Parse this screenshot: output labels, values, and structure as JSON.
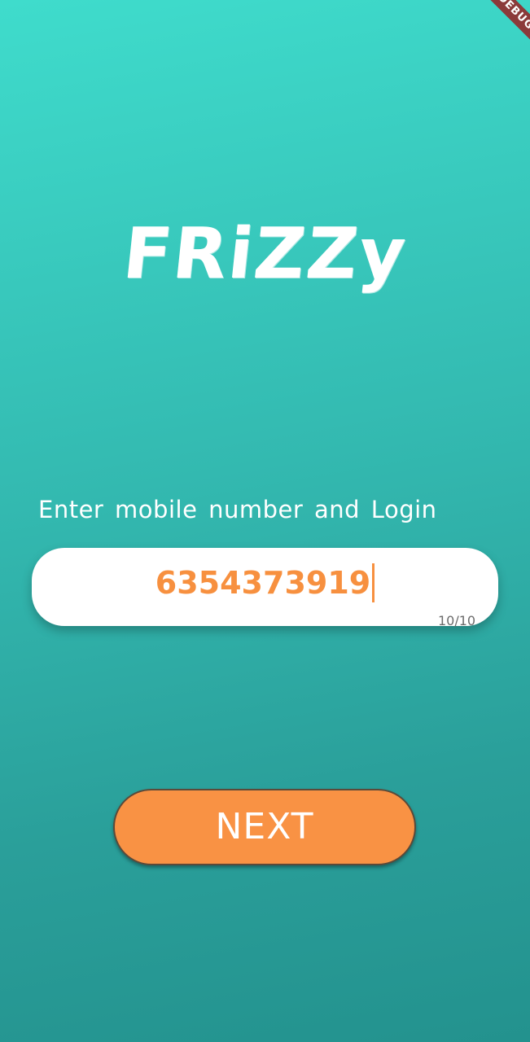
{
  "app": {
    "logo_text": "FRiZZy",
    "debug_banner": "DEBUG"
  },
  "login": {
    "prompt": "Enter mobile number and Login",
    "phone_value": "6354373919",
    "char_counter": "10/10",
    "next_label": "NEXT"
  },
  "colors": {
    "gradient_top": "#3fdccc",
    "gradient_bottom": "#23928e",
    "accent_orange": "#f99244",
    "field_text": "#f7903f",
    "field_bg": "#ffffff"
  }
}
